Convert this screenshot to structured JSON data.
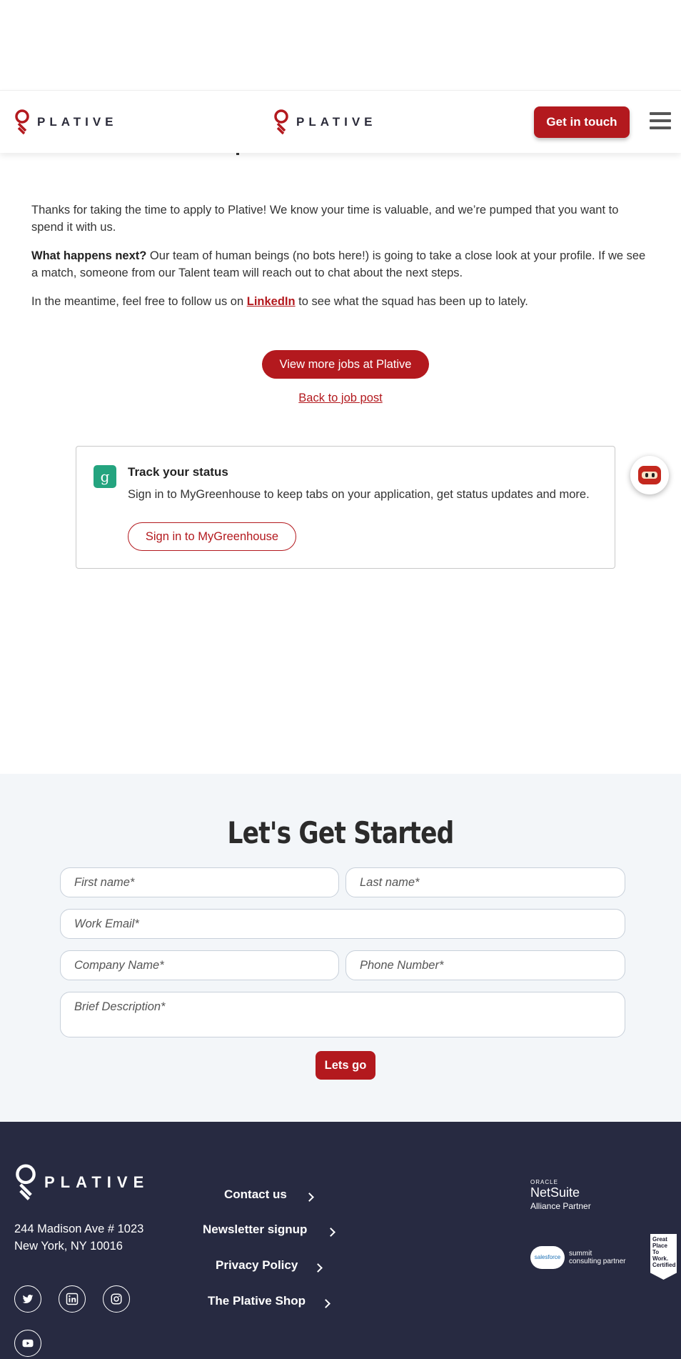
{
  "header": {
    "logo_text": "PLATIVE",
    "cta_label": "Get in touch",
    "menu_icon": "hamburger-icon"
  },
  "confirmation": {
    "intro": "Thanks for taking the time to apply to Plative! We know your time is valuable, and we’re pumped that you want to spend it with us.",
    "next_heading": "What happens next?",
    "next_body": " Our team of human beings (no bots here!) is going to take a close look at your profile. If we see a match, someone from our Talent team will reach out to chat about the next steps.",
    "meantime_prefix": "In the meantime, feel free to follow us on ",
    "linkedin_label": "LinkedIn",
    "meantime_suffix": " to see what the squad has been up to lately.",
    "view_jobs_label": "View more jobs at Plative",
    "back_link_label": "Back to job post"
  },
  "track": {
    "icon_letter": "g",
    "title": "Track your status",
    "description": "Sign in to MyGreenhouse to keep tabs on your application, get status updates and more.",
    "sign_in_label": "Sign in to MyGreenhouse"
  },
  "get_started": {
    "title": "Let's Get Started",
    "first_name_placeholder": "First name*",
    "last_name_placeholder": "Last name*",
    "email_placeholder": "Work Email*",
    "company_placeholder": "Company Name*",
    "phone_placeholder": "Phone Number*",
    "description_placeholder": "Brief Description*",
    "submit_label": "Lets go"
  },
  "footer": {
    "logo_text": "PLATIVE",
    "address_line1": "244 Madison Ave # 1023",
    "address_line2": "New York, NY 10016",
    "links": [
      "Contact us",
      "Newsletter signup",
      "Privacy Policy",
      "The Plative Shop"
    ],
    "social_icons": [
      "twitter-icon",
      "linkedin-icon",
      "instagram-icon",
      "youtube-icon"
    ],
    "netsuite_small": "ORACLE",
    "netsuite_big": "NetSuite",
    "netsuite_sub": "Alliance Partner",
    "salesforce_cloud": "salesforce",
    "salesforce_text1": "summit",
    "salesforce_text2": "consulting partner",
    "gptw_text": "Great Place To Work. Certified"
  },
  "colors": {
    "brand_red": "#b3191e",
    "footer_bg": "#272a41",
    "section_bg": "#f3f6f9",
    "greenhouse_green": "#24a47f"
  }
}
